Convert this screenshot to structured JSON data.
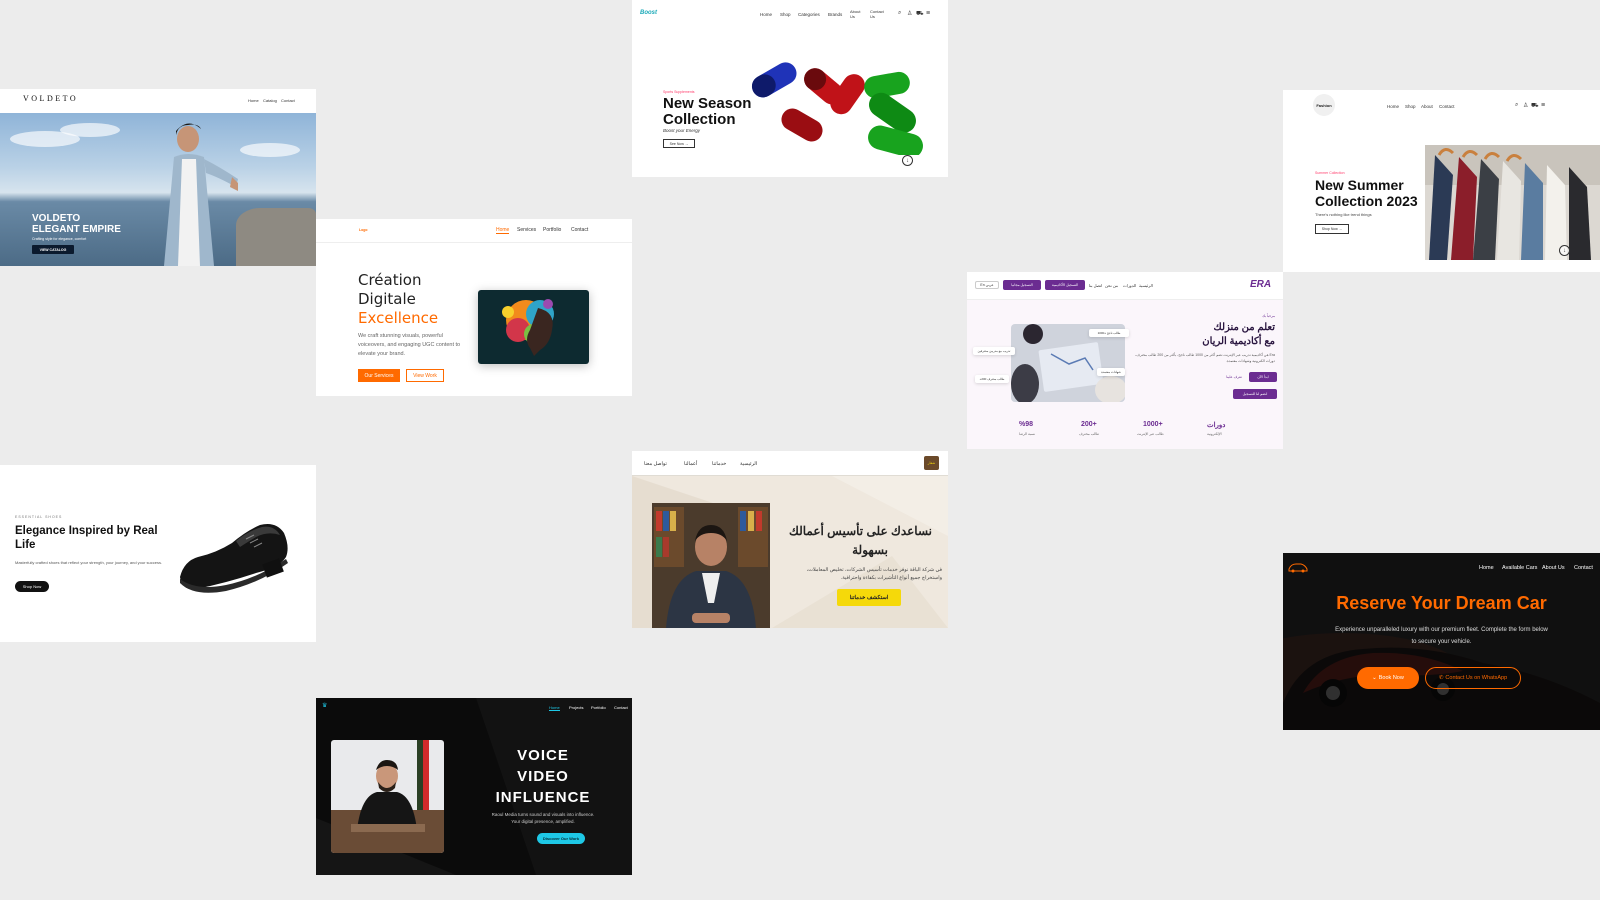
{
  "voldeto": {
    "logo": "VOLDETO",
    "nav": [
      "Home",
      "Catalog",
      "Contact"
    ],
    "headline_1": "VOLDETO",
    "headline_2": "ELEGANT EMPIRE",
    "tagline": "Crafting style for elegance, comfort",
    "cta": "VIEW CATALOG"
  },
  "creation": {
    "logo": "Logo",
    "nav": [
      "Home",
      "Services",
      "Portfolio",
      "Contact"
    ],
    "title_1": "Création",
    "title_2": "Digitale",
    "title_3": "Excellence",
    "description": "We craft stunning visuals, powerful voiceovers, and engaging UGC content to elevate your brand.",
    "primary_cta": "Our Services",
    "secondary_cta": "View Work",
    "accent": "#ff6a00"
  },
  "season": {
    "logo": "Boost",
    "nav": [
      "Home",
      "Shop",
      "Categories",
      "Brands",
      "About Us",
      "Contact Us"
    ],
    "eyebrow": "Sports Supplements",
    "title_1": "New Season",
    "title_2": "Collection",
    "subtitle": "Boost your Energy",
    "cta": "See Now →"
  },
  "era": {
    "logo": "ERA",
    "nav": [
      "الرئيسية",
      "الدورات",
      "من نحن",
      "اتصل بنا"
    ],
    "btn_academy": "التسجيل الأكاديمية",
    "btn_primary": "التسجيل مجانيا",
    "lang": "En عربي",
    "eyebrow": "مرحباً بك",
    "title_1": "تعلم من منزلك",
    "title_2": "مع أكاديمية الريان",
    "description": "Era هي أكاديمية تدريب عبر الإنترنت تضم أكثر من 1000 طالب ناجح، بأكثر من 200 طالب محترف، دورات الكترونية وشهادات معتمدة.",
    "cta_primary": "ابدأ الآن",
    "cta_secondary": "تعرف علينا",
    "cta_register": "انضم لنا للتسجيل",
    "badges": [
      "1000+ طالب ناجح",
      "تدريب مع مدربين محترفين",
      "شهادات معتمدة",
      "+200 طالب محترف"
    ],
    "stats": [
      {
        "value": "دورات",
        "label": "الإلكترونية"
      },
      {
        "value": "1000+",
        "label": "طالب عبر الإنترنت"
      },
      {
        "value": "200+",
        "label": "طالب محترف"
      },
      {
        "value": "%98",
        "label": "نسبة الرضا"
      }
    ],
    "accent": "#6b2c91"
  },
  "fashion": {
    "logo": "Fashion",
    "nav": [
      "Home",
      "Shop",
      "About",
      "Contact"
    ],
    "eyebrow": "Summer Collection",
    "title_1": "New Summer",
    "title_2": "Collection 2023",
    "subtitle": "There's nothing like trend things",
    "cta": "Shop Now →"
  },
  "shoes": {
    "eyebrow": "ESSENTIAL SHOES",
    "title_1": "Elegance Inspired by Real",
    "title_2": "Life",
    "description": "Masterfully crafted shoes that reflect your strength, your journey, and your success.",
    "cta": "Shop Now"
  },
  "arabic": {
    "logo": "شعار",
    "nav": [
      "الرئيسية",
      "خدماتنا",
      "أعمالنا",
      "تواصل معنا"
    ],
    "title_1": "نساعدك على تأسيس أعمالك",
    "title_2": "بسهولة",
    "description_1": "في شركة الباقة نوفر خدمات تأسيس الشركات، تخليص المعاملات،",
    "description_2": "واستخراج جميع أنواع التأشيرات بكفاءة واحترافية.",
    "cta": "استكشف خدماتنا",
    "accent": "#f5d90a"
  },
  "car": {
    "nav": [
      "Home",
      "Available Cars",
      "About Us",
      "Contact"
    ],
    "title": "Reserve Your Dream Car",
    "description_1": "Experience unparalleled luxury with our premium fleet. Complete the form below",
    "description_2": "to secure your vehicle.",
    "cta_primary": "Book Now",
    "cta_secondary": "Contact Us on WhatsApp",
    "accent": "#ff6a00"
  },
  "voice": {
    "nav": [
      "Home",
      "Projects",
      "Portfolio",
      "Contact"
    ],
    "line_1": "VOICE",
    "line_2": "VIDEO",
    "line_3": "INFLUENCE",
    "description_1": "Raoul Media turns sound and visuals into influence.",
    "description_2": "Your digital presence, amplified.",
    "cta": "Discover Our Work",
    "accent": "#1ec8e6"
  }
}
